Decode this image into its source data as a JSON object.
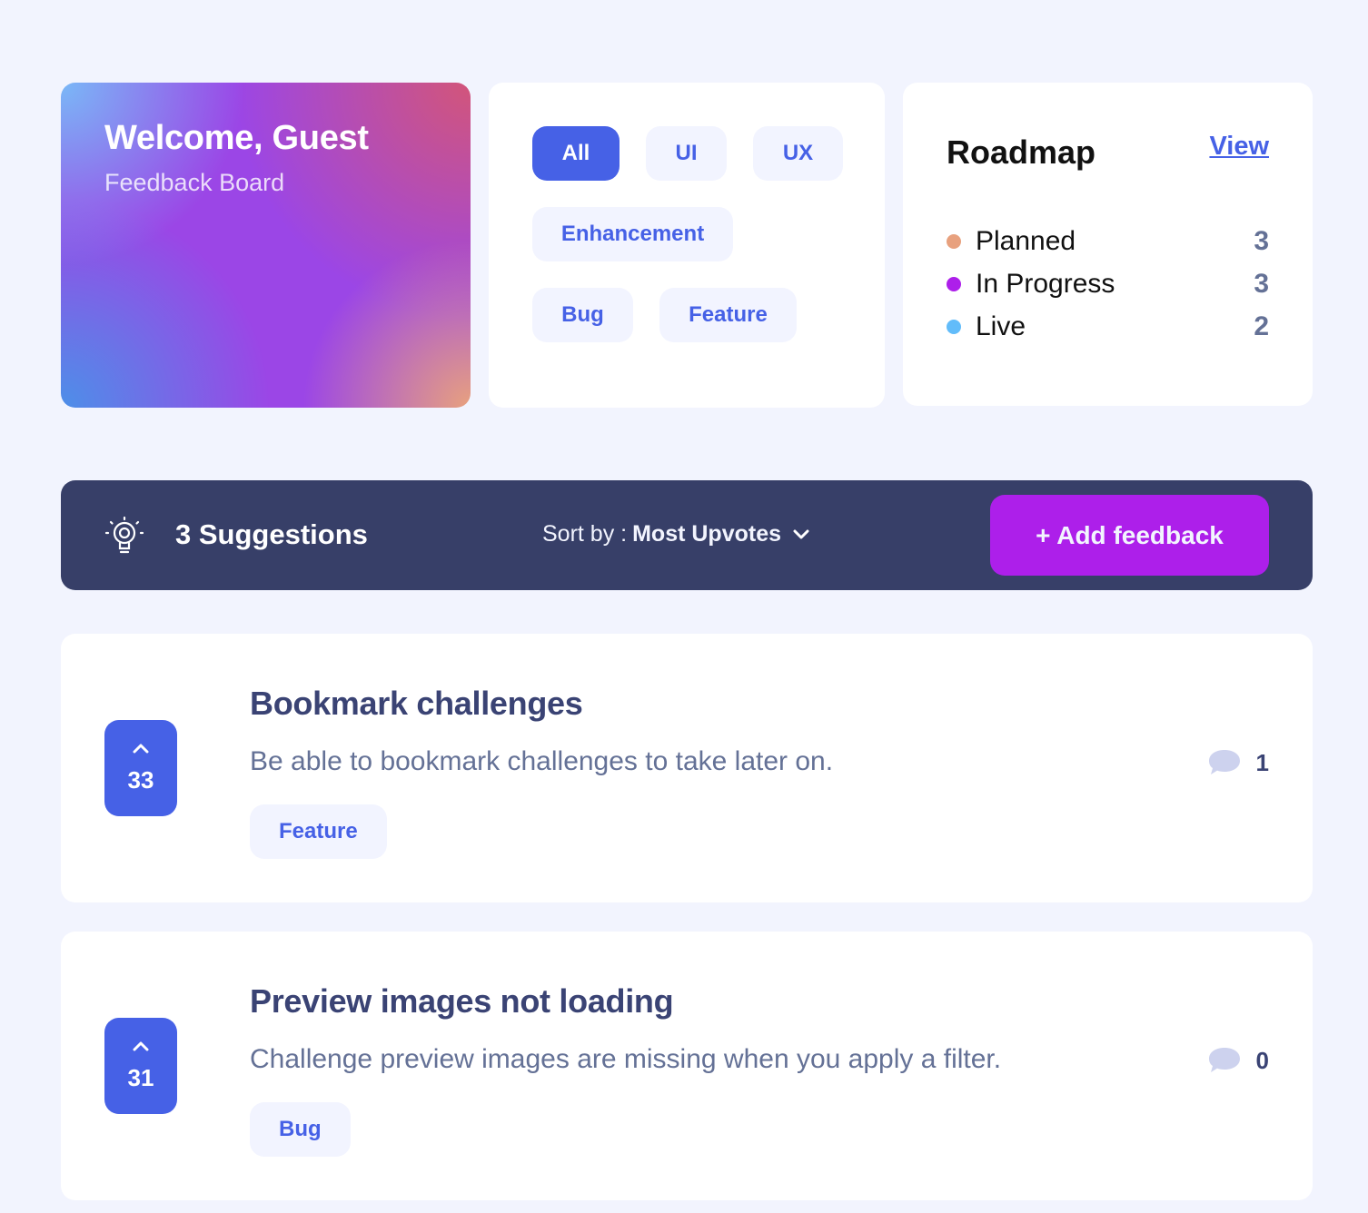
{
  "brand": {
    "title": "Welcome, Guest",
    "subtitle": "Feedback Board"
  },
  "filters": [
    {
      "label": "All",
      "active": true
    },
    {
      "label": "UI",
      "active": false
    },
    {
      "label": "UX",
      "active": false
    },
    {
      "label": "Enhancement",
      "active": false
    },
    {
      "label": "Bug",
      "active": false
    },
    {
      "label": "Feature",
      "active": false
    }
  ],
  "roadmap": {
    "title": "Roadmap",
    "view_label": "View",
    "items": [
      {
        "label": "Planned",
        "count": "3",
        "color": "#e8a17e"
      },
      {
        "label": "In Progress",
        "count": "3",
        "color": "#ad1fea"
      },
      {
        "label": "Live",
        "count": "2",
        "color": "#62bcfa"
      }
    ]
  },
  "toolbar": {
    "suggestions": "3 Suggestions",
    "sort_label": "Sort by :",
    "sort_value": "Most Upvotes",
    "add_label": "+ Add feedback"
  },
  "feedback": [
    {
      "title": "Bookmark challenges",
      "description": "Be able to bookmark challenges to take later on.",
      "tag": "Feature",
      "upvotes": "33",
      "comments": "1"
    },
    {
      "title": "Preview images not loading",
      "description": "Challenge preview images are missing when you apply a filter.",
      "tag": "Bug",
      "upvotes": "31",
      "comments": "0"
    }
  ]
}
